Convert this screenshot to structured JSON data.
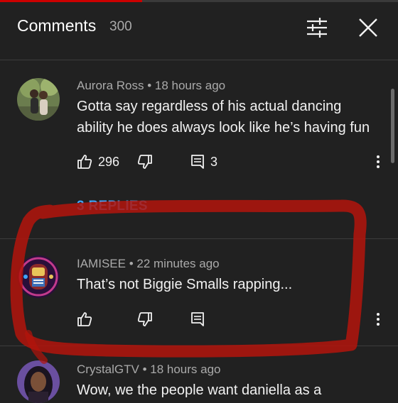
{
  "header": {
    "title": "Comments",
    "count": "300"
  },
  "comments": [
    {
      "author": "Aurora Ross",
      "time": "18 hours ago",
      "text_lines": [
        "Gotta say regardless of his actual dancing",
        "ability he does always look like he’s having fun"
      ],
      "likes": "296",
      "replies": "3"
    },
    {
      "author": "IAMISEE",
      "time": "22 minutes ago",
      "text_lines": [
        "That’s not Biggie Smalls rapping..."
      ]
    },
    {
      "author": "CrystalGTV",
      "time": "18 hours ago",
      "text_lines": [
        "Wow, we the people want daniella as a"
      ]
    }
  ],
  "replies_link": "3 REPLIES",
  "colors": {
    "background": "#212121",
    "link": "#3ea6ff",
    "annotation": "#b3140c"
  }
}
